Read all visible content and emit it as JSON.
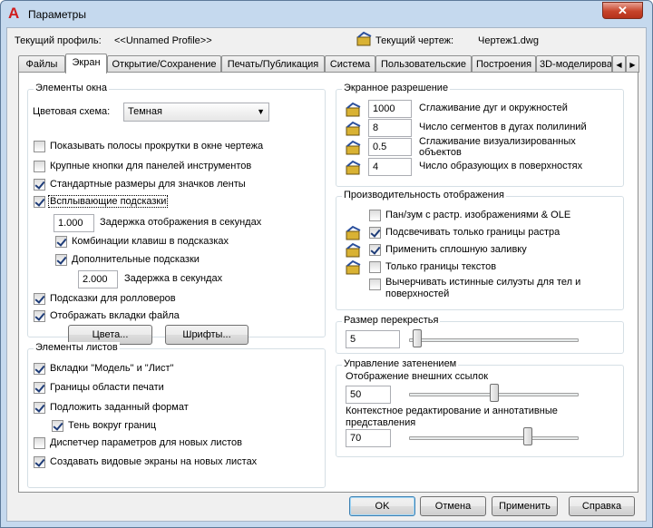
{
  "window": {
    "title": "Параметры",
    "close": "✕"
  },
  "profile": {
    "label": "Текущий профиль:",
    "value": "<<Unnamed Profile>>",
    "drawing_label": "Текущий чертеж:",
    "drawing_value": "Чертеж1.dwg"
  },
  "tabs": [
    {
      "label": "Файлы"
    },
    {
      "label": "Экран",
      "active": true
    },
    {
      "label": "Открытие/Сохранение"
    },
    {
      "label": "Печать/Публикация"
    },
    {
      "label": "Система"
    },
    {
      "label": "Пользовательские"
    },
    {
      "label": "Построения"
    },
    {
      "label": "3D-моделирова"
    }
  ],
  "tab_scroll": {
    "left": "◀",
    "right": "▶"
  },
  "window_elements": {
    "title": "Элементы окна",
    "color_scheme_label": "Цветовая схема:",
    "color_scheme_value": "Темная",
    "scrollbars": {
      "label": "Показывать полосы прокрутки в окне чертежа",
      "checked": false
    },
    "large_buttons": {
      "label": "Крупные кнопки для панелей инструментов",
      "checked": false
    },
    "ribbon_icons": {
      "label": "Стандартные размеры для значков ленты",
      "checked": true
    },
    "tooltips": {
      "label": "Всплывающие подсказки",
      "checked": true
    },
    "tooltip_delay_value": "1.000",
    "tooltip_delay_label": "Задержка отображения в секундах",
    "shortcut_keys": {
      "label": "Комбинации клавиш в подсказках",
      "checked": true
    },
    "extended_tooltips": {
      "label": "Дополнительные подсказки",
      "checked": true
    },
    "extended_delay_value": "2.000",
    "extended_delay_label": "Задержка в секундах",
    "rollover": {
      "label": "Подсказки для ролловеров",
      "checked": true
    },
    "file_tabs": {
      "label": "Отображать вкладки файла",
      "checked": true
    },
    "colors_button": "Цвета...",
    "fonts_button": "Шрифты..."
  },
  "layout_elements": {
    "title": "Элементы листов",
    "model_layout_tabs": {
      "label": "Вкладки \"Модель\" и \"Лист\"",
      "checked": true
    },
    "printable_area": {
      "label": "Границы области печати",
      "checked": true
    },
    "paper_background": {
      "label": "Подложить заданный формат",
      "checked": true
    },
    "paper_shadow": {
      "label": "Тень вокруг границ",
      "checked": true
    },
    "page_setup": {
      "label": "Диспетчер параметров для новых листов",
      "checked": false
    },
    "viewports": {
      "label": "Создавать видовые экраны на новых листах",
      "checked": true
    }
  },
  "resolution": {
    "title": "Экранное разрешение",
    "items": [
      {
        "value": "1000",
        "label": "Сглаживание дуг и окружностей"
      },
      {
        "value": "8",
        "label": "Число сегментов в дугах полилиний"
      },
      {
        "value": "0.5",
        "label": "Сглаживание визуализированных объектов"
      },
      {
        "value": "4",
        "label": "Число образующих в поверхностях"
      }
    ]
  },
  "performance": {
    "title": "Производительность отображения",
    "items": [
      {
        "label": "Пан/зум с растр. изображениями & OLE",
        "checked": false
      },
      {
        "label": "Подсвечивать только границы растра",
        "checked": true
      },
      {
        "label": "Применить сплошную заливку",
        "checked": true
      },
      {
        "label": "Только границы текстов",
        "checked": false
      },
      {
        "label": "Вычерчивать истинные силуэты для тел и поверхностей",
        "checked": false
      }
    ]
  },
  "crosshair": {
    "title": "Размер перекрестья",
    "value": "5",
    "level": 0.05
  },
  "fade": {
    "title": "Управление затенением",
    "xref_label": "Отображение внешних ссылок",
    "xref_value": "50",
    "xref_level": 0.5,
    "inplace_label": "Контекстное редактирование и аннотативные представления",
    "inplace_value": "70",
    "inplace_level": 0.7
  },
  "buttons": {
    "ok": "OK",
    "cancel": "Отмена",
    "apply": "Применить",
    "help": "Справка"
  }
}
